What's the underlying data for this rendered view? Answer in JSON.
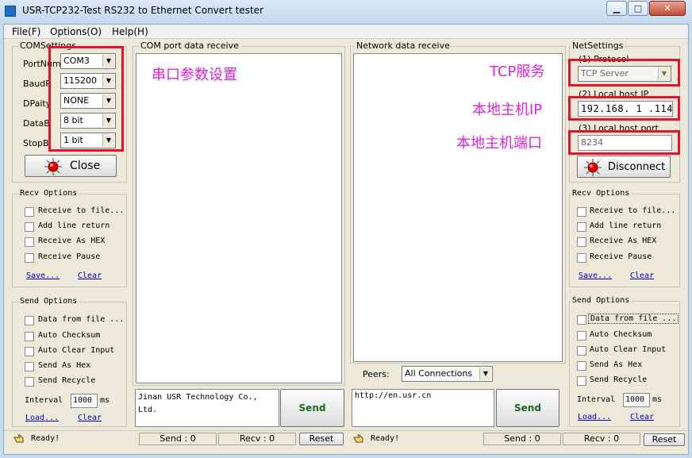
{
  "window": {
    "title": "USR-TCP232-Test  RS232 to Ethernet Convert tester",
    "minimize": "▁",
    "maximize": "□",
    "close": "✕"
  },
  "menu": [
    "File(F)",
    "Options(O)",
    "Help(H)"
  ],
  "com_settings": {
    "legend": "COMSettings",
    "fields": [
      {
        "label": "PortNum",
        "value": "COM3"
      },
      {
        "label": "BaudR",
        "value": "115200"
      },
      {
        "label": "DPaity",
        "value": "NONE"
      },
      {
        "label": "DataB",
        "value": "8 bit"
      },
      {
        "label": "StopB",
        "value": "1 bit"
      }
    ],
    "close_label": "Close"
  },
  "recv_options": {
    "legend": "Recv Options",
    "checkboxes": [
      "Receive to file...",
      "Add line return",
      "Receive As HEX",
      "Receive Pause"
    ],
    "save_link": "Save...",
    "clear_link": "Clear"
  },
  "send_options": {
    "legend": "Send Options",
    "checkboxes": [
      "Data from file ...",
      "Auto Checksum",
      "Auto Clear Input",
      "Send As Hex",
      "Send Recycle"
    ],
    "interval_label": "Interval",
    "interval_value": "1000",
    "interval_unit": "ms",
    "load_link": "Load...",
    "clear_link": "Clear"
  },
  "com_panel": {
    "legend": "COM port data receive",
    "annotation": "串口参数设置",
    "send_text": "Jinan USR Technology Co., Ltd.",
    "send_label": "Send"
  },
  "net_panel": {
    "legend": "Network data receive",
    "annotation_protocol": "TCP服务",
    "annotation_ip": "本地主机IP",
    "annotation_port": "本地主机端口",
    "peers_label": "Peers:",
    "peers_value": "All Connections",
    "send_text": "http://en.usr.cn",
    "send_label": "Send"
  },
  "net_settings": {
    "legend": "NetSettings",
    "protocol_label": "(1) Protocol",
    "protocol_value": "TCP Server",
    "ip_label": "(2) Local host IP",
    "ip_value": "192.168. 1 .114",
    "port_label": "(3) Local host port",
    "port_value": "8234",
    "disconnect_label": "Disconnect"
  },
  "status": {
    "left_ready": "Ready!",
    "left_send": "Send : 0",
    "left_recv": "Recv : 0",
    "left_reset": "Reset",
    "right_ready": "Ready!",
    "right_send": "Send : 0",
    "right_recv": "Recv : 0",
    "right_reset": "Reset"
  },
  "colors": {
    "annotation": "#e020e0",
    "highlight_box": "#e8102a",
    "send_button_text": "#186c18"
  }
}
